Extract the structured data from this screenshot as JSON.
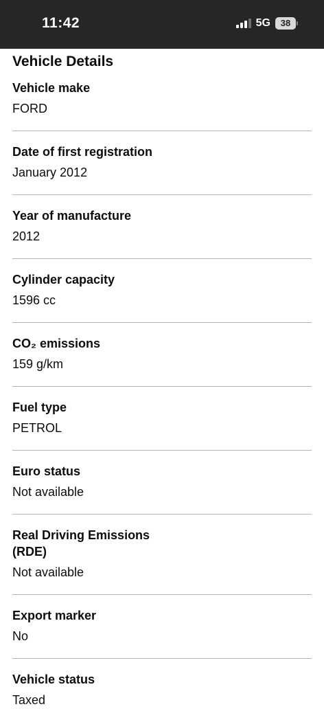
{
  "status_bar": {
    "time": "11:42",
    "network": "5G",
    "battery": "38",
    "icons": [
      "signal-icon",
      "battery-icon"
    ]
  },
  "page": {
    "title": "Vehicle Details"
  },
  "details": [
    {
      "label": "Vehicle make",
      "value": "FORD"
    },
    {
      "label": "Date of first registration",
      "value": "January 2012"
    },
    {
      "label": "Year of manufacture",
      "value": "2012"
    },
    {
      "label": "Cylinder capacity",
      "value": "1596 cc"
    },
    {
      "label": "CO₂ emissions",
      "value": "159 g/km"
    },
    {
      "label": "Fuel type",
      "value": "PETROL"
    },
    {
      "label": "Euro status",
      "value": "Not available"
    },
    {
      "label": "Real Driving Emissions (RDE)",
      "value": "Not available"
    },
    {
      "label": "Export marker",
      "value": "No"
    },
    {
      "label": "Vehicle status",
      "value": "Taxed"
    }
  ],
  "colors": {
    "status_bar_bg": "#262626",
    "text": "#0b0c0c",
    "divider": "#b1b4b6"
  }
}
